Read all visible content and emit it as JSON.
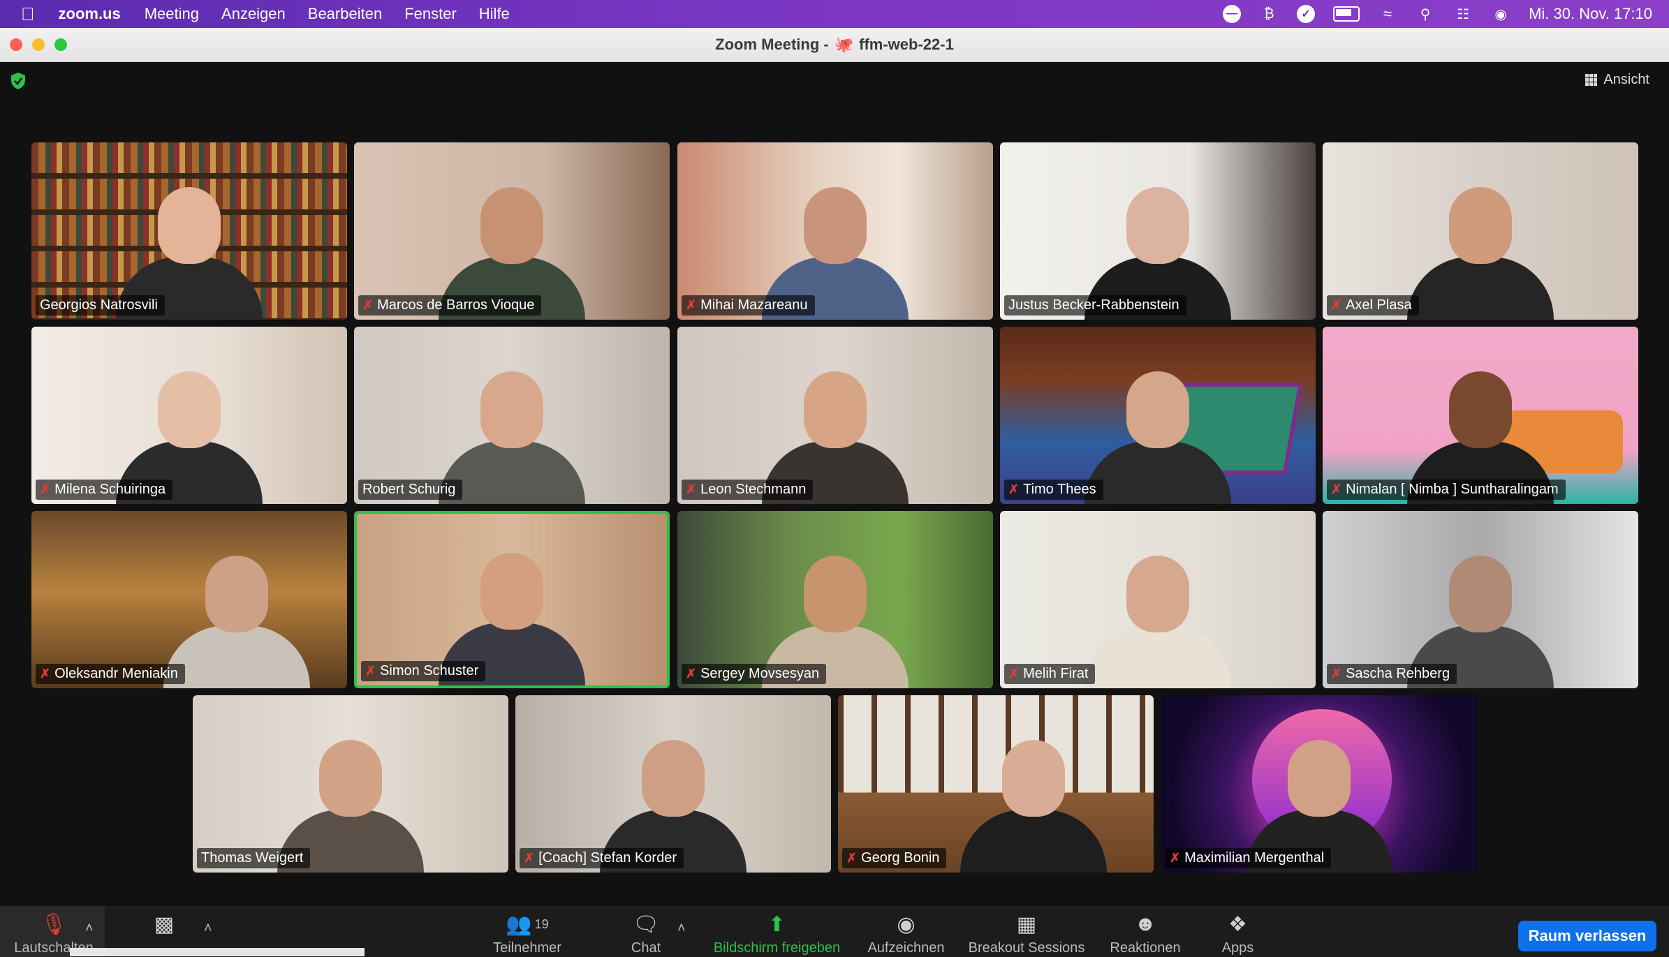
{
  "menubar": {
    "app_name": "zoom.us",
    "items": [
      "Meeting",
      "Anzeigen",
      "Bearbeiten",
      "Fenster",
      "Hilfe"
    ],
    "clock": "Mi. 30. Nov. 17:10"
  },
  "window": {
    "title": "Zoom Meeting -  ffm-web-22-1",
    "title_prefix": "Zoom Meeting -",
    "title_suffix": "ffm-web-22-1"
  },
  "view_button": {
    "label": "Ansicht"
  },
  "participants": [
    {
      "name": "Georgios Natrosvili",
      "muted": false
    },
    {
      "name": "Marcos de Barros Vioque",
      "muted": true
    },
    {
      "name": "Mihai Mazareanu",
      "muted": true
    },
    {
      "name": "Justus Becker-Rabbenstein",
      "muted": false
    },
    {
      "name": "Axel Plasa",
      "muted": true
    },
    {
      "name": "Milena Schuiringa",
      "muted": true
    },
    {
      "name": "Robert Schurig",
      "muted": false
    },
    {
      "name": "Leon Stechmann",
      "muted": true
    },
    {
      "name": "Timo Thees",
      "muted": true
    },
    {
      "name": "Nimalan [ Nimba ] Suntharalingam",
      "muted": true
    },
    {
      "name": "Oleksandr Meniakin",
      "muted": true
    },
    {
      "name": "Simon Schuster",
      "muted": true,
      "speaking": true
    },
    {
      "name": "Sergey Movsesyan",
      "muted": true
    },
    {
      "name": "Melih Firat",
      "muted": true
    },
    {
      "name": "Sascha Rehberg",
      "muted": true
    },
    {
      "name": "Thomas Weigert",
      "muted": false
    },
    {
      "name": "[Coach] Stefan Korder",
      "muted": true
    },
    {
      "name": "Georg Bonin",
      "muted": true
    },
    {
      "name": "Maximilian Mergenthal",
      "muted": true
    }
  ],
  "toolbar": {
    "mute_label": "Lautschalten",
    "participants_label": "Teilnehmer",
    "participants_count": "19",
    "chat_label": "Chat",
    "share_label": "Bildschirm freigeben",
    "record_label": "Aufzeichnen",
    "breakout_label": "Breakout Sessions",
    "reactions_label": "Reaktionen",
    "apps_label": "Apps",
    "leave_label": "Raum verlassen"
  }
}
